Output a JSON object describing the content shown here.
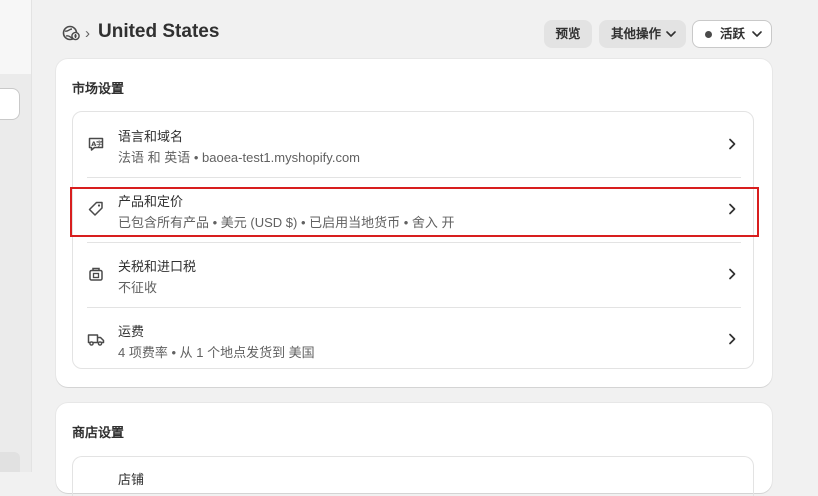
{
  "header": {
    "breadcrumb_separator": "›",
    "title": "United States",
    "preview_label": "预览",
    "more_actions_label": "其他操作",
    "status_label": "活跃"
  },
  "market_settings": {
    "title": "市场设置",
    "rows": [
      {
        "icon": "language-icon",
        "title": "语言和域名",
        "subtitle": "法语 和 英语 • baoea-test1.myshopify.com"
      },
      {
        "icon": "price-tag-icon",
        "title": "产品和定价",
        "subtitle": "已包含所有产品 • 美元 (USD $) • 已启用当地货币 • 舍入 开"
      },
      {
        "icon": "customs-icon",
        "title": "关税和进口税",
        "subtitle": "不征收"
      },
      {
        "icon": "truck-icon",
        "title": "运费",
        "subtitle": "4 项费率 • 从 1 个地点发货到 美国"
      }
    ]
  },
  "store_settings": {
    "title": "商店设置",
    "first_row_peek": "店铺"
  },
  "colors": {
    "highlight": "#d81e1e",
    "background": "#f1f1f1",
    "card": "#ffffff"
  }
}
